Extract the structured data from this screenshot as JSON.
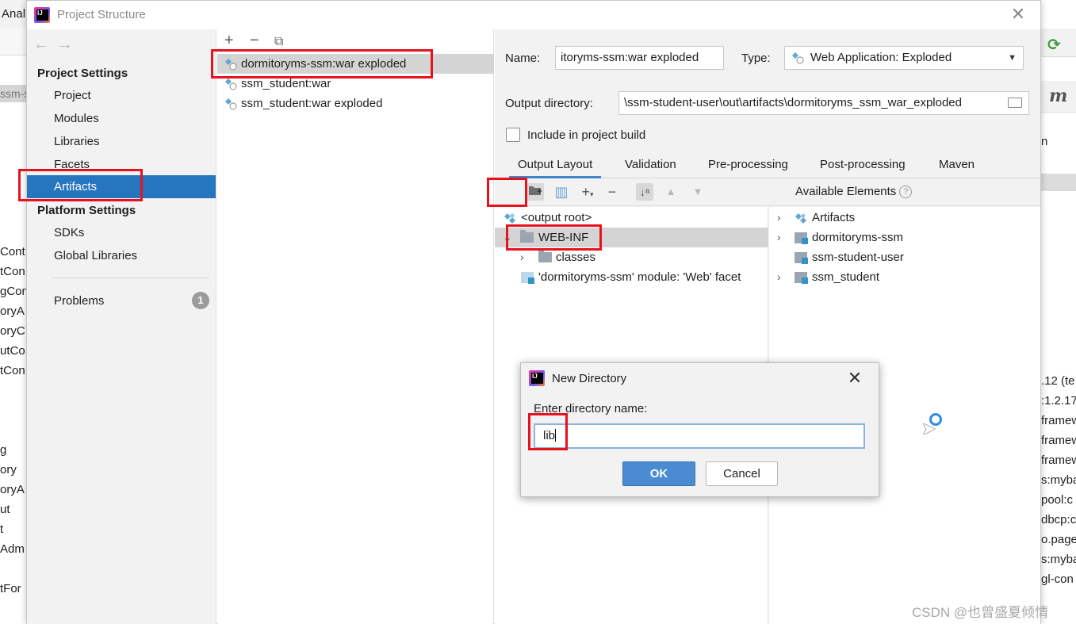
{
  "background": {
    "left_title": "Anal",
    "left_tab": "ssm-s",
    "left_code_lines": [
      "Cont",
      "tCon",
      "gCon",
      "oryA",
      "oryC",
      "utCo",
      "tCon",
      "g",
      "ory",
      "oryA",
      "ut",
      "t",
      "Adm",
      "tFor"
    ],
    "right_partial": "n",
    "right_deps": [
      ".12 (te",
      ":1.2.17",
      "framew",
      "framew",
      "framew",
      "s:myba",
      "pool:c",
      "dbcp:c",
      "o.page",
      "s:myba",
      "gl-con"
    ]
  },
  "dialog": {
    "title": "Project Structure",
    "close_icon": "close-icon"
  },
  "sidebar": {
    "project_settings": "Project Settings",
    "items_project": [
      "Project",
      "Modules",
      "Libraries",
      "Facets",
      "Artifacts"
    ],
    "selected": "Artifacts",
    "platform_settings": "Platform Settings",
    "items_platform": [
      "SDKs",
      "Global Libraries"
    ],
    "problems": "Problems",
    "problems_count": "1"
  },
  "artifacts": {
    "items": [
      "dormitoryms-ssm:war exploded",
      "ssm_student:war",
      "ssm_student:war exploded"
    ],
    "selected": "dormitoryms-ssm:war exploded"
  },
  "details": {
    "name_label": "Name:",
    "name_value": "itoryms-ssm:war exploded",
    "type_label": "Type:",
    "type_value": "Web Application: Exploded",
    "output_label": "Output directory:",
    "output_value": "\\ssm-student-user\\out\\artifacts\\dormitoryms_ssm_war_exploded",
    "include_label": "Include in project build",
    "include_checked": false,
    "tabs": [
      "Output Layout",
      "Validation",
      "Pre-processing",
      "Post-processing",
      "Maven"
    ],
    "active_tab": "Output Layout",
    "available_label": "Available Elements",
    "layout_tree": {
      "root": "<output root>",
      "web_inf": "WEB-INF",
      "classes": "classes",
      "facet": "'dormitoryms-ssm' module: 'Web' facet"
    },
    "available_tree": [
      "Artifacts",
      "dormitoryms-ssm",
      "ssm-student-user",
      "ssm_student"
    ]
  },
  "new_directory": {
    "title": "New Directory",
    "prompt": "Enter directory name:",
    "value": "lib",
    "ok": "OK",
    "cancel": "Cancel"
  },
  "watermark": "CSDN @也曾盛夏倾情",
  "colors": {
    "selection": "#2675bf",
    "highlight_box": "#e8121e",
    "ok_button": "#4a8bd1"
  }
}
